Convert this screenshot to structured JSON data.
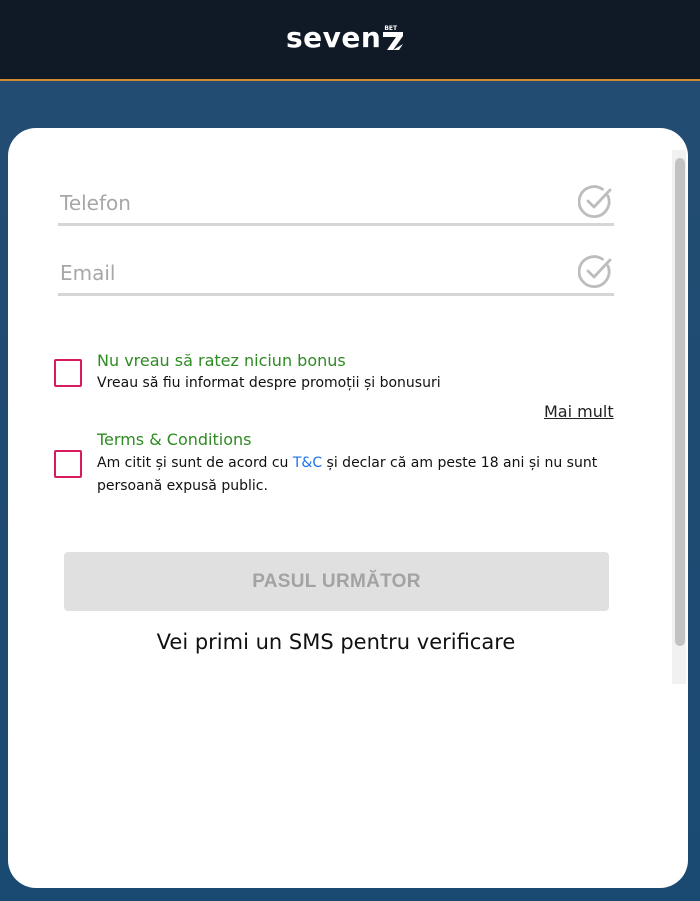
{
  "header": {
    "logo_text": "seven",
    "logo_badge": "BET",
    "colors": {
      "background": "#0f1a26",
      "accent_line": "#d08a2c"
    }
  },
  "form": {
    "phone": {
      "placeholder": "Telefon",
      "value": "",
      "icon": "check-circle-icon"
    },
    "email": {
      "placeholder": "Email",
      "value": "",
      "icon": "check-circle-icon"
    }
  },
  "options": {
    "bonus": {
      "title": "Nu vreau să ratez niciun bonus",
      "text": "Vreau să fiu informat despre promoții și bonusuri",
      "checked": false
    },
    "more_link": "Mai mult",
    "terms": {
      "title": "Terms & Conditions",
      "text_before": "Am citit și sunt de acord cu ",
      "link": "T&C",
      "text_after": " și declar că am peste 18 ani și nu sunt persoană expusă public.",
      "checked": false
    }
  },
  "actions": {
    "next_label": "PASUL URMĂTOR",
    "next_disabled": true
  },
  "footer_note": "Vei primi un SMS pentru verificare",
  "colors": {
    "checkbox_border": "#d81b60",
    "option_title": "#2e8b22",
    "link": "#1a73e8"
  }
}
